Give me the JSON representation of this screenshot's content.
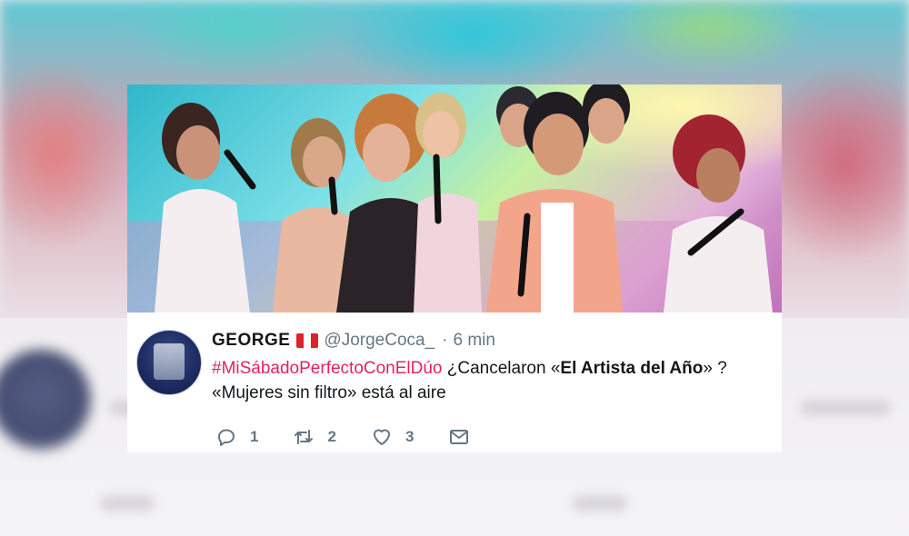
{
  "tweet": {
    "name": "GEORGE",
    "flag": "Peru",
    "handle": "@JorgeCoca_",
    "separator": "·",
    "time": "6 min",
    "text": {
      "hashtag": "#MiSábadoPerfectoConElDúo",
      "part1": " ¿Cancelaron «",
      "bold": "El Artista del Año",
      "part2": "» ?",
      "line2": "«Mujeres sin filtro» está al aire"
    },
    "actions": {
      "reply_count": "1",
      "retweet_count": "2",
      "like_count": "3"
    }
  },
  "colors": {
    "hashtag": "#e0245e",
    "text": "#14171a",
    "secondary": "#657786",
    "flag_red": "#e0202b"
  },
  "icons": [
    "reply-icon",
    "retweet-icon",
    "like-icon",
    "message-icon"
  ]
}
